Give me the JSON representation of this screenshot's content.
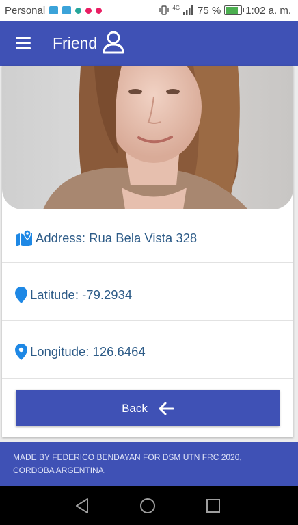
{
  "status_bar": {
    "carrier": "Personal",
    "network": "4G",
    "battery_percent": "75 %",
    "battery_level": 0.75,
    "time": "1:02 a. m.",
    "notification_icons": [
      "voicemail-icon",
      "voicemail-icon",
      "dot-icon",
      "minus-circle-icon",
      "minus-circle-icon"
    ]
  },
  "app_bar": {
    "title": "Friend",
    "menu_icon": "hamburger-menu-icon",
    "user_icon": "person-outline-icon"
  },
  "profile": {
    "photo": "friend-portrait-photo",
    "address_label": "Address: Rua Bela Vista  328",
    "latitude_label": "Latitude: -79.2934",
    "longitude_label": "Longitude: 126.6464"
  },
  "back_button": {
    "label": "Back",
    "icon": "arrow-left-icon"
  },
  "footer": {
    "line1": "MADE BY FEDERICO BENDAYAN FOR DSM UTN FRC 2020,",
    "line2": "CORDOBA ARGENTINA."
  },
  "colors": {
    "primary": "#3f51b5",
    "text_link": "#2e5c88",
    "icon_blue": "#1e88e5"
  }
}
